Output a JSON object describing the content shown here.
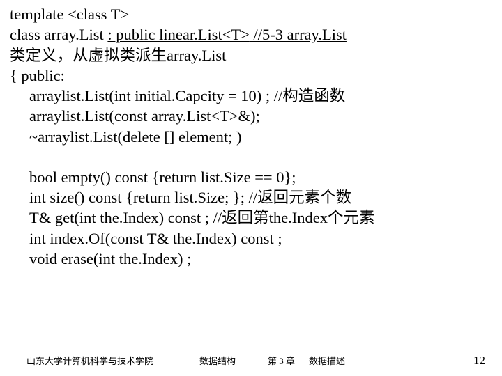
{
  "lines": {
    "l1": "template <class T>",
    "l2a": "class  array.List ",
    "l2b": " : public linear.List<T>",
    "l2c": " //5-3 array.List",
    "l3": "类定义，从虚拟类派生array.List",
    "l4": "{ public:",
    "l5": "arraylist.List(int initial.Capcity = 10) ; //构造函数",
    "l6": "arraylist.List(const array.List<T>&);",
    "l7": "~arraylist.List(delete [] element; )",
    "l8": "bool empty() const  {return list.Size == 0};",
    "l9": "int size() const {return list.Size; }; //返回元素个数",
    "l10": "T& get(int the.Index) const ; //返回第the.Index个元素",
    "l11": "int index.Of(const T&  the.Index) const ;",
    "l12": "void erase(int the.Index) ;"
  },
  "footer": {
    "org": "山东大学计算机科学与技术学院",
    "course": "数据结构",
    "chapter": "第 3 章",
    "subject": "数据描述",
    "page": "12"
  }
}
